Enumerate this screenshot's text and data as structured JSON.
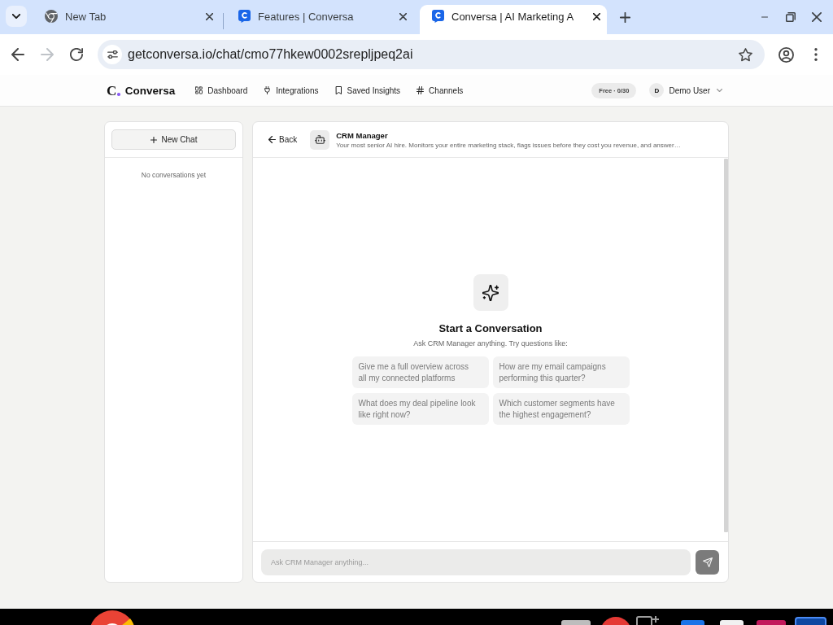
{
  "browser": {
    "tabs": [
      {
        "title": "New Tab",
        "kind": "newtab",
        "selected": false
      },
      {
        "title": "Features | Conversa",
        "kind": "site",
        "selected": false
      },
      {
        "title": "Conversa | AI Marketing A",
        "kind": "site",
        "selected": true
      }
    ],
    "forward_disabled": true,
    "address": "getconversa.io/chat/cmo77hkew0002srepljpeq2ai"
  },
  "header": {
    "logo_mark": "C",
    "brand": "Conversa",
    "nav": [
      {
        "label": "Dashboard"
      },
      {
        "label": "Integrations"
      },
      {
        "label": "Saved Insights"
      },
      {
        "label": "Channels"
      }
    ],
    "plan_badge": "Free · 0/30",
    "user": {
      "initial": "D",
      "name": "Demo User"
    }
  },
  "sidebar": {
    "new_chat_button": "New Chat",
    "empty_state": "No conversations yet"
  },
  "chat": {
    "back_button": "Back",
    "agent": {
      "name": "CRM Manager",
      "description": "Your most senior AI hire. Monitors your entire marketing stack, flags issues before they cost you revenue, and answer…"
    },
    "empty_state": {
      "title": "Start a Conversation",
      "subtitle": "Ask CRM Manager anything. Try questions like:",
      "suggestions": [
        "Give me a full overview across all my connected platforms",
        "How are my email campaigns performing this quarter?",
        "What does my deal pipeline look like right now?",
        "Which customer segments have the highest engagement?"
      ]
    },
    "composer": {
      "placeholder": "Ask CRM Manager anything...",
      "send_disabled": true
    }
  }
}
